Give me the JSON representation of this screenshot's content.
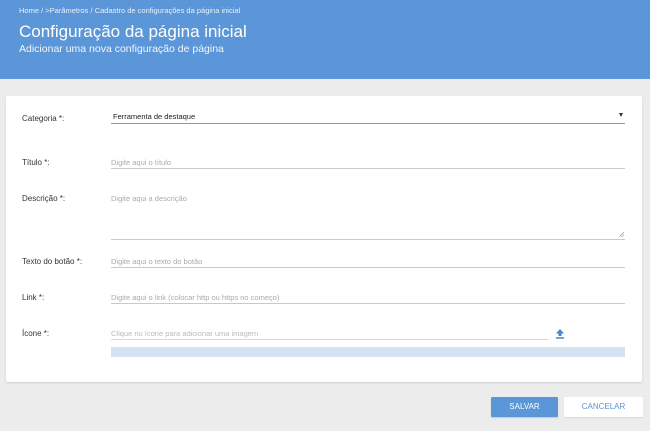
{
  "header": {
    "breadcrumb": [
      "Home",
      ">Parâmetros",
      "Cadastro de configurações da página inicial"
    ],
    "breadcrumb_sep": " / ",
    "title": "Configuração da página inicial",
    "subtitle": "Adicionar uma nova configuração de página"
  },
  "form": {
    "categoria": {
      "label": "Categoria *:",
      "value": "Ferramenta de destaque"
    },
    "titulo": {
      "label": "Título *:",
      "placeholder": "Digite aqui o título"
    },
    "descricao": {
      "label": "Descrição *:",
      "placeholder": "Digite aqui a descrição"
    },
    "texto_botao": {
      "label": "Texto do botão *:",
      "placeholder": "Digite aqui o texto do botão"
    },
    "link": {
      "label": "Link *:",
      "placeholder": "Digite aqui o link (colocar http ou https no começo)"
    },
    "icone": {
      "label": "Ícone *:",
      "placeholder": "Clique no ícone para adicionar uma imagem",
      "upload_progress": 0
    }
  },
  "actions": {
    "save_label": "SALVAR",
    "cancel_label": "CANCELAR"
  },
  "colors": {
    "accent": "#5b96d9",
    "background": "#ececec",
    "progress_track": "#d5e2f2"
  },
  "icons": {
    "upload": "upload-icon",
    "dropdown": "caret-down-icon",
    "resize": "resize-handle-icon"
  }
}
